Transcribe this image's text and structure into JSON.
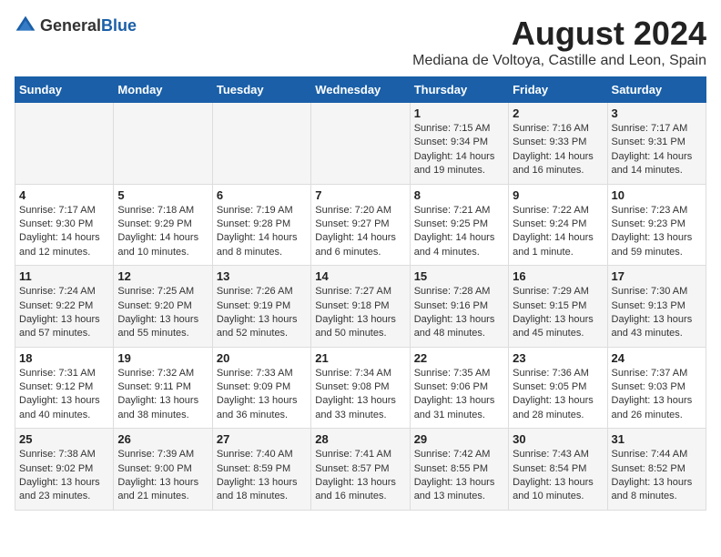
{
  "header": {
    "logo_general": "General",
    "logo_blue": "Blue",
    "main_title": "August 2024",
    "subtitle": "Mediana de Voltoya, Castille and Leon, Spain"
  },
  "columns": [
    "Sunday",
    "Monday",
    "Tuesday",
    "Wednesday",
    "Thursday",
    "Friday",
    "Saturday"
  ],
  "weeks": [
    [
      {
        "day": "",
        "text": ""
      },
      {
        "day": "",
        "text": ""
      },
      {
        "day": "",
        "text": ""
      },
      {
        "day": "",
        "text": ""
      },
      {
        "day": "1",
        "text": "Sunrise: 7:15 AM\nSunset: 9:34 PM\nDaylight: 14 hours\nand 19 minutes."
      },
      {
        "day": "2",
        "text": "Sunrise: 7:16 AM\nSunset: 9:33 PM\nDaylight: 14 hours\nand 16 minutes."
      },
      {
        "day": "3",
        "text": "Sunrise: 7:17 AM\nSunset: 9:31 PM\nDaylight: 14 hours\nand 14 minutes."
      }
    ],
    [
      {
        "day": "4",
        "text": "Sunrise: 7:17 AM\nSunset: 9:30 PM\nDaylight: 14 hours\nand 12 minutes."
      },
      {
        "day": "5",
        "text": "Sunrise: 7:18 AM\nSunset: 9:29 PM\nDaylight: 14 hours\nand 10 minutes."
      },
      {
        "day": "6",
        "text": "Sunrise: 7:19 AM\nSunset: 9:28 PM\nDaylight: 14 hours\nand 8 minutes."
      },
      {
        "day": "7",
        "text": "Sunrise: 7:20 AM\nSunset: 9:27 PM\nDaylight: 14 hours\nand 6 minutes."
      },
      {
        "day": "8",
        "text": "Sunrise: 7:21 AM\nSunset: 9:25 PM\nDaylight: 14 hours\nand 4 minutes."
      },
      {
        "day": "9",
        "text": "Sunrise: 7:22 AM\nSunset: 9:24 PM\nDaylight: 14 hours\nand 1 minute."
      },
      {
        "day": "10",
        "text": "Sunrise: 7:23 AM\nSunset: 9:23 PM\nDaylight: 13 hours\nand 59 minutes."
      }
    ],
    [
      {
        "day": "11",
        "text": "Sunrise: 7:24 AM\nSunset: 9:22 PM\nDaylight: 13 hours\nand 57 minutes."
      },
      {
        "day": "12",
        "text": "Sunrise: 7:25 AM\nSunset: 9:20 PM\nDaylight: 13 hours\nand 55 minutes."
      },
      {
        "day": "13",
        "text": "Sunrise: 7:26 AM\nSunset: 9:19 PM\nDaylight: 13 hours\nand 52 minutes."
      },
      {
        "day": "14",
        "text": "Sunrise: 7:27 AM\nSunset: 9:18 PM\nDaylight: 13 hours\nand 50 minutes."
      },
      {
        "day": "15",
        "text": "Sunrise: 7:28 AM\nSunset: 9:16 PM\nDaylight: 13 hours\nand 48 minutes."
      },
      {
        "day": "16",
        "text": "Sunrise: 7:29 AM\nSunset: 9:15 PM\nDaylight: 13 hours\nand 45 minutes."
      },
      {
        "day": "17",
        "text": "Sunrise: 7:30 AM\nSunset: 9:13 PM\nDaylight: 13 hours\nand 43 minutes."
      }
    ],
    [
      {
        "day": "18",
        "text": "Sunrise: 7:31 AM\nSunset: 9:12 PM\nDaylight: 13 hours\nand 40 minutes."
      },
      {
        "day": "19",
        "text": "Sunrise: 7:32 AM\nSunset: 9:11 PM\nDaylight: 13 hours\nand 38 minutes."
      },
      {
        "day": "20",
        "text": "Sunrise: 7:33 AM\nSunset: 9:09 PM\nDaylight: 13 hours\nand 36 minutes."
      },
      {
        "day": "21",
        "text": "Sunrise: 7:34 AM\nSunset: 9:08 PM\nDaylight: 13 hours\nand 33 minutes."
      },
      {
        "day": "22",
        "text": "Sunrise: 7:35 AM\nSunset: 9:06 PM\nDaylight: 13 hours\nand 31 minutes."
      },
      {
        "day": "23",
        "text": "Sunrise: 7:36 AM\nSunset: 9:05 PM\nDaylight: 13 hours\nand 28 minutes."
      },
      {
        "day": "24",
        "text": "Sunrise: 7:37 AM\nSunset: 9:03 PM\nDaylight: 13 hours\nand 26 minutes."
      }
    ],
    [
      {
        "day": "25",
        "text": "Sunrise: 7:38 AM\nSunset: 9:02 PM\nDaylight: 13 hours\nand 23 minutes."
      },
      {
        "day": "26",
        "text": "Sunrise: 7:39 AM\nSunset: 9:00 PM\nDaylight: 13 hours\nand 21 minutes."
      },
      {
        "day": "27",
        "text": "Sunrise: 7:40 AM\nSunset: 8:59 PM\nDaylight: 13 hours\nand 18 minutes."
      },
      {
        "day": "28",
        "text": "Sunrise: 7:41 AM\nSunset: 8:57 PM\nDaylight: 13 hours\nand 16 minutes."
      },
      {
        "day": "29",
        "text": "Sunrise: 7:42 AM\nSunset: 8:55 PM\nDaylight: 13 hours\nand 13 minutes."
      },
      {
        "day": "30",
        "text": "Sunrise: 7:43 AM\nSunset: 8:54 PM\nDaylight: 13 hours\nand 10 minutes."
      },
      {
        "day": "31",
        "text": "Sunrise: 7:44 AM\nSunset: 8:52 PM\nDaylight: 13 hours\nand 8 minutes."
      }
    ]
  ]
}
